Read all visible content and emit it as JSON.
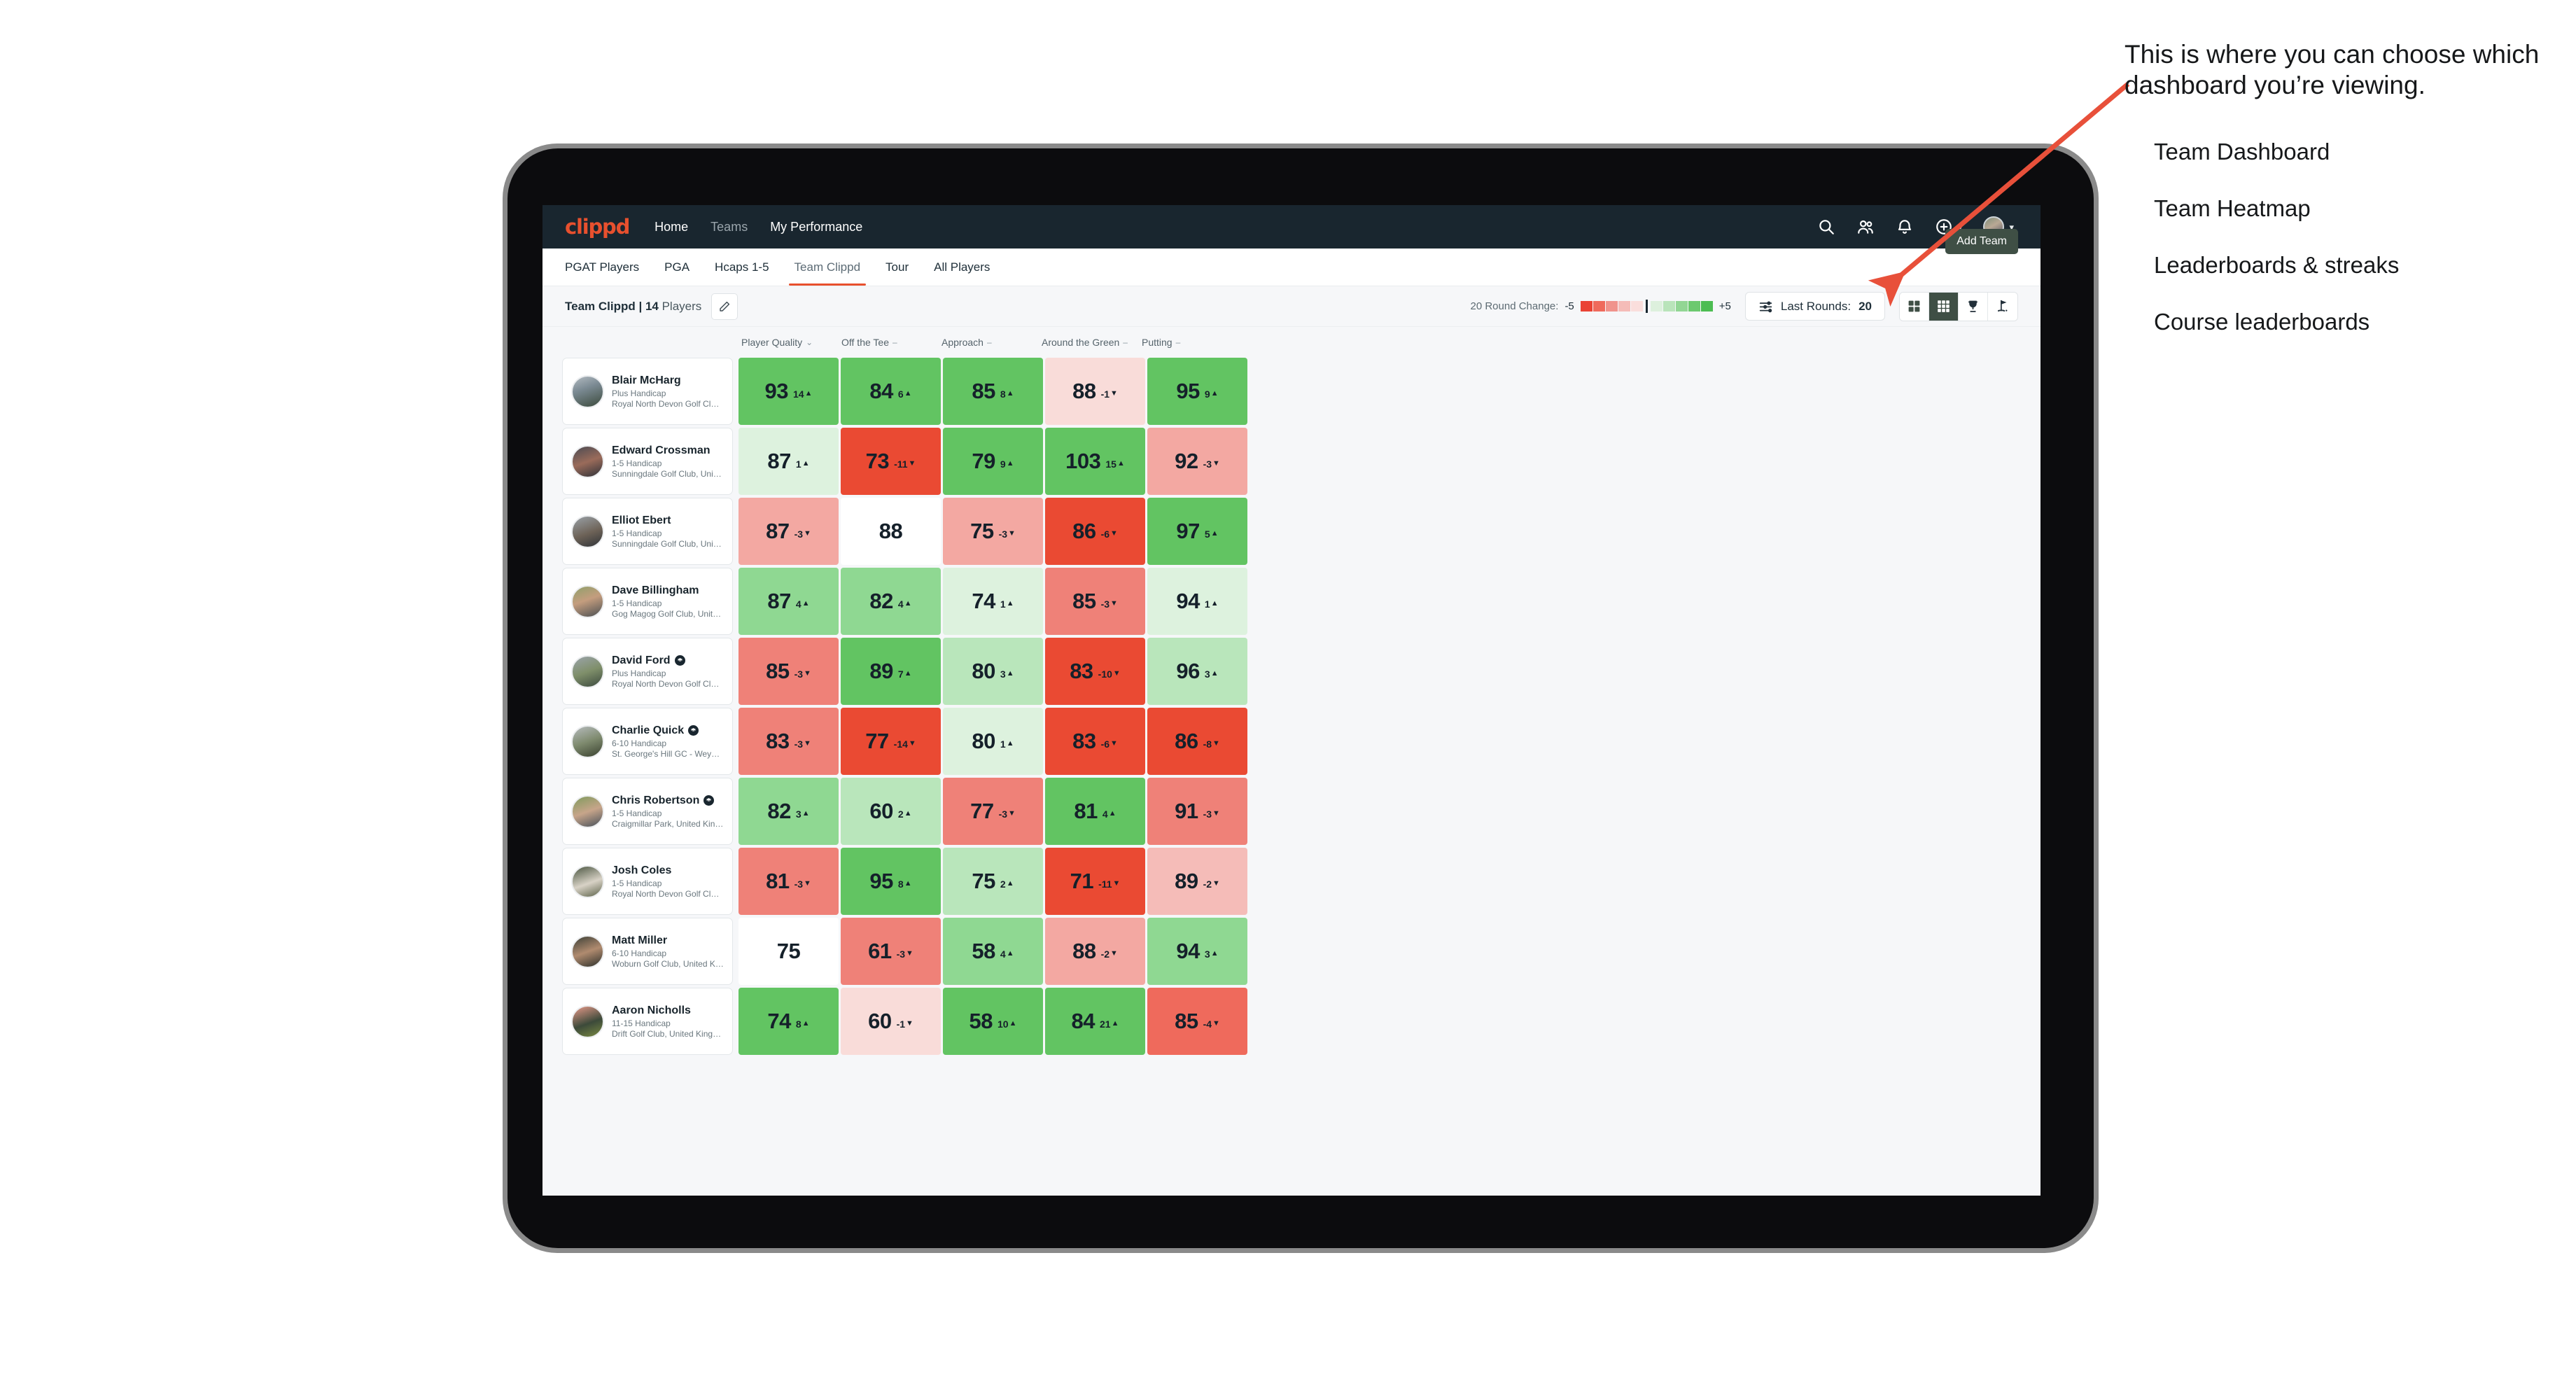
{
  "app": {
    "brand": "clippd",
    "nav_links": [
      {
        "label": "Home",
        "dim": false
      },
      {
        "label": "Teams",
        "dim": true
      },
      {
        "label": "My Performance",
        "dim": false
      }
    ],
    "nav_icons": [
      "search-icon",
      "people-icon",
      "bell-icon",
      "plus-circle-icon",
      "avatar"
    ]
  },
  "tabs": [
    {
      "label": "PGAT Players",
      "active": false
    },
    {
      "label": "PGA",
      "active": false
    },
    {
      "label": "Hcaps 1-5",
      "active": false
    },
    {
      "label": "Team Clippd",
      "active": true
    },
    {
      "label": "Tour",
      "active": false
    },
    {
      "label": "All Players",
      "active": false
    }
  ],
  "add_team_label": "Add Team",
  "control_bar": {
    "team_name": "Team Clippd",
    "separator": " | ",
    "player_count": "14",
    "players_word": " Players",
    "edit_icon": "pencil-icon",
    "legend_title": "20 Round Change:",
    "legend_min": "-5",
    "legend_max": "+5",
    "legend_colors": [
      "#ea4335",
      "#ef6a5c",
      "#f0938c",
      "#f5bcb8",
      "#fadedc",
      "#ddf0dd",
      "#b9e4ba",
      "#92d694",
      "#6cc96f",
      "#4cbd52"
    ],
    "rounds_label": "Last Rounds:",
    "rounds_value": "20",
    "view_buttons": [
      {
        "name": "cards-view",
        "active": false
      },
      {
        "name": "heatmap-view",
        "active": true
      },
      {
        "name": "leaderboard-view",
        "active": false
      },
      {
        "name": "course-view",
        "active": false
      }
    ]
  },
  "columns": [
    {
      "label": "Player Quality",
      "mark": "chevron-down"
    },
    {
      "label": "Off the Tee",
      "mark": "dash"
    },
    {
      "label": "Approach",
      "mark": "dash"
    },
    {
      "label": "Around the Green",
      "mark": "dash"
    },
    {
      "label": "Putting",
      "mark": "dash"
    }
  ],
  "colors": {
    "brand": "#e8502e",
    "navbar": "#19262f",
    "accent_dark": "#3f4f45",
    "green_strong": "#62c462",
    "green_mid": "#8fd892",
    "green_light": "#b9e6bb",
    "green_pale": "#ddf2de",
    "red_strong": "#ea4a33",
    "red_mid": "#ef8178",
    "red_light": "#f3a8a2",
    "red_pale": "#f9dcd9",
    "neutral": "#ffffff"
  },
  "players": [
    {
      "name": "Blair McHarg",
      "verified": false,
      "handicap": "Plus Handicap",
      "club": "Royal North Devon Golf Club, United Kingdom",
      "avatar": "linear-gradient(160deg,#b4bcc2 0%,#7b8a93 40%,#3b4a3c 100%)",
      "cells": [
        {
          "value": "93",
          "delta": "14",
          "dir": "up",
          "bg": "#62c462"
        },
        {
          "value": "84",
          "delta": "6",
          "dir": "up",
          "bg": "#62c462"
        },
        {
          "value": "85",
          "delta": "8",
          "dir": "up",
          "bg": "#62c462"
        },
        {
          "value": "88",
          "delta": "-1",
          "dir": "down",
          "bg": "#f9dcd9"
        },
        {
          "value": "95",
          "delta": "9",
          "dir": "up",
          "bg": "#62c462"
        }
      ]
    },
    {
      "name": "Edward Crossman",
      "verified": false,
      "handicap": "1-5 Handicap",
      "club": "Sunningdale Golf Club, United Kingdom",
      "avatar": "linear-gradient(160deg,#4a4a52 0%,#9a6b5a 50%,#2e3138 100%)",
      "cells": [
        {
          "value": "87",
          "delta": "1",
          "dir": "up",
          "bg": "#ddf2de"
        },
        {
          "value": "73",
          "delta": "-11",
          "dir": "down",
          "bg": "#ea4a33"
        },
        {
          "value": "79",
          "delta": "9",
          "dir": "up",
          "bg": "#62c462"
        },
        {
          "value": "103",
          "delta": "15",
          "dir": "up",
          "bg": "#62c462"
        },
        {
          "value": "92",
          "delta": "-3",
          "dir": "down",
          "bg": "#f3a8a2"
        }
      ]
    },
    {
      "name": "Elliot Ebert",
      "verified": false,
      "handicap": "1-5 Handicap",
      "club": "Sunningdale Golf Club, United Kingdom",
      "avatar": "linear-gradient(160deg,#9aa2a8 0%,#6d6257 55%,#2f3338 100%)",
      "cells": [
        {
          "value": "87",
          "delta": "-3",
          "dir": "down",
          "bg": "#f3a8a2"
        },
        {
          "value": "88",
          "delta": "",
          "dir": "none",
          "bg": "#ffffff"
        },
        {
          "value": "75",
          "delta": "-3",
          "dir": "down",
          "bg": "#f3a8a2"
        },
        {
          "value": "86",
          "delta": "-6",
          "dir": "down",
          "bg": "#ea4a33"
        },
        {
          "value": "97",
          "delta": "5",
          "dir": "up",
          "bg": "#62c462"
        }
      ]
    },
    {
      "name": "Dave Billingham",
      "verified": false,
      "handicap": "1-5 Handicap",
      "club": "Gog Magog Golf Club, United Kingdom",
      "avatar": "linear-gradient(160deg,#8fa06a 0%,#c49d7e 45%,#4a4f52 100%)",
      "cells": [
        {
          "value": "87",
          "delta": "4",
          "dir": "up",
          "bg": "#8fd892"
        },
        {
          "value": "82",
          "delta": "4",
          "dir": "up",
          "bg": "#8fd892"
        },
        {
          "value": "74",
          "delta": "1",
          "dir": "up",
          "bg": "#ddf2de"
        },
        {
          "value": "85",
          "delta": "-3",
          "dir": "down",
          "bg": "#ef8178"
        },
        {
          "value": "94",
          "delta": "1",
          "dir": "up",
          "bg": "#ddf2de"
        }
      ]
    },
    {
      "name": "David Ford",
      "verified": true,
      "handicap": "Plus Handicap",
      "club": "Royal North Devon Golf Club, United Kingdom",
      "avatar": "linear-gradient(160deg,#9ba4ab 0%,#7f8f6a 50%,#3c4a3e 100%)",
      "cells": [
        {
          "value": "85",
          "delta": "-3",
          "dir": "down",
          "bg": "#ef8178"
        },
        {
          "value": "89",
          "delta": "7",
          "dir": "up",
          "bg": "#62c462"
        },
        {
          "value": "80",
          "delta": "3",
          "dir": "up",
          "bg": "#b9e6bb"
        },
        {
          "value": "83",
          "delta": "-10",
          "dir": "down",
          "bg": "#ea4a33"
        },
        {
          "value": "96",
          "delta": "3",
          "dir": "up",
          "bg": "#b9e6bb"
        }
      ]
    },
    {
      "name": "Charlie Quick",
      "verified": true,
      "handicap": "6-10 Handicap",
      "club": "St. George's Hill GC - Weybridge - Surrey, Uni...",
      "avatar": "linear-gradient(160deg,#b7bcbe 0%,#7e8a6e 50%,#39412f 100%)",
      "cells": [
        {
          "value": "83",
          "delta": "-3",
          "dir": "down",
          "bg": "#ef8178"
        },
        {
          "value": "77",
          "delta": "-14",
          "dir": "down",
          "bg": "#ea4a33"
        },
        {
          "value": "80",
          "delta": "1",
          "dir": "up",
          "bg": "#ddf2de"
        },
        {
          "value": "83",
          "delta": "-6",
          "dir": "down",
          "bg": "#ea4a33"
        },
        {
          "value": "86",
          "delta": "-8",
          "dir": "down",
          "bg": "#ea4a33"
        }
      ]
    },
    {
      "name": "Chris Robertson",
      "verified": true,
      "handicap": "1-5 Handicap",
      "club": "Craigmillar Park, United Kingdom",
      "avatar": "linear-gradient(160deg,#7f9a5c 0%,#c7a58a 50%,#46505a 100%)",
      "cells": [
        {
          "value": "82",
          "delta": "3",
          "dir": "up",
          "bg": "#8fd892"
        },
        {
          "value": "60",
          "delta": "2",
          "dir": "up",
          "bg": "#b9e6bb"
        },
        {
          "value": "77",
          "delta": "-3",
          "dir": "down",
          "bg": "#ef8178"
        },
        {
          "value": "81",
          "delta": "4",
          "dir": "up",
          "bg": "#62c462"
        },
        {
          "value": "91",
          "delta": "-3",
          "dir": "down",
          "bg": "#ef8178"
        }
      ]
    },
    {
      "name": "Josh Coles",
      "verified": false,
      "handicap": "1-5 Handicap",
      "club": "Royal North Devon Golf Club, United Kingdom",
      "avatar": "linear-gradient(160deg,#49543f 0%,#d8d2c6 55%,#5b6148 100%)",
      "cells": [
        {
          "value": "81",
          "delta": "-3",
          "dir": "down",
          "bg": "#ef8178"
        },
        {
          "value": "95",
          "delta": "8",
          "dir": "up",
          "bg": "#62c462"
        },
        {
          "value": "75",
          "delta": "2",
          "dir": "up",
          "bg": "#b9e6bb"
        },
        {
          "value": "71",
          "delta": "-11",
          "dir": "down",
          "bg": "#ea4a33"
        },
        {
          "value": "89",
          "delta": "-2",
          "dir": "down",
          "bg": "#f5bcb8"
        }
      ]
    },
    {
      "name": "Matt Miller",
      "verified": false,
      "handicap": "6-10 Handicap",
      "club": "Woburn Golf Club, United Kingdom",
      "avatar": "linear-gradient(160deg,#3b3f36 0%,#b08b6f 50%,#2b2f2a 100%)",
      "cells": [
        {
          "value": "75",
          "delta": "",
          "dir": "none",
          "bg": "#ffffff"
        },
        {
          "value": "61",
          "delta": "-3",
          "dir": "down",
          "bg": "#ef8178"
        },
        {
          "value": "58",
          "delta": "4",
          "dir": "up",
          "bg": "#8fd892"
        },
        {
          "value": "88",
          "delta": "-2",
          "dir": "down",
          "bg": "#f3a8a2"
        },
        {
          "value": "94",
          "delta": "3",
          "dir": "up",
          "bg": "#8fd892"
        }
      ]
    },
    {
      "name": "Aaron Nicholls",
      "verified": false,
      "handicap": "11-15 Handicap",
      "club": "Drift Golf Club, United Kingdom",
      "avatar": "linear-gradient(160deg,#e89a8a 0%,#3c4a3a 55%,#7a8a42 100%)",
      "cells": [
        {
          "value": "74",
          "delta": "8",
          "dir": "up",
          "bg": "#62c462"
        },
        {
          "value": "60",
          "delta": "-1",
          "dir": "down",
          "bg": "#f9dcd9"
        },
        {
          "value": "58",
          "delta": "10",
          "dir": "up",
          "bg": "#62c462"
        },
        {
          "value": "84",
          "delta": "21",
          "dir": "up",
          "bg": "#62c462"
        },
        {
          "value": "85",
          "delta": "-4",
          "dir": "down",
          "bg": "#ef6a5c"
        }
      ]
    }
  ],
  "annotation": {
    "headline": "This is where you can choose which dashboard you’re viewing.",
    "items": [
      "Team Dashboard",
      "Team Heatmap",
      "Leaderboards & streaks",
      "Course leaderboards"
    ],
    "arrow_color": "#e8503a"
  }
}
